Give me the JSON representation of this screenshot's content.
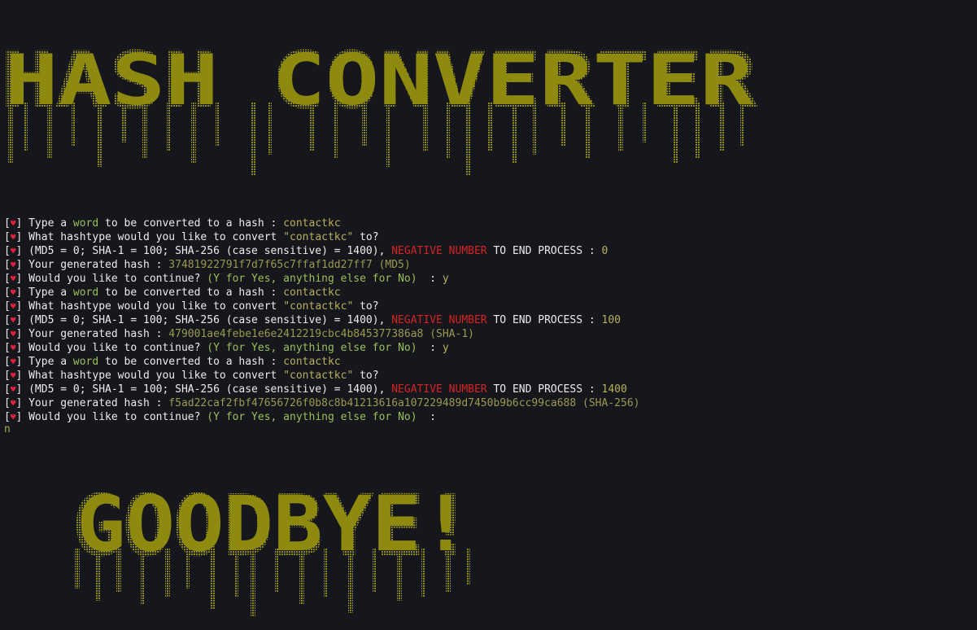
{
  "theme": {
    "background": "#16171c",
    "banner_color": "#8e8a10",
    "heart_color": "#e0213a"
  },
  "banners": {
    "top": "HASH CONVERTER",
    "bottom": "GOODBYE!"
  },
  "prompt_icon": "heart-icon",
  "log": [
    {
      "kind": "word",
      "pre": " Type a ",
      "green": "word",
      "post": " to be converted to a hash : ",
      "input": "contactkc"
    },
    {
      "kind": "which",
      "pre": " What hashtype would you like to convert ",
      "quoted": "\"contactkc\"",
      "post": " to?"
    },
    {
      "kind": "menu",
      "pre": " (MD5 = 0; SHA-1 = 100; SHA-256 (case sensitive) = 1400), ",
      "red": "NEGATIVE NUMBER",
      "post": " TO END PROCESS : ",
      "input": "0"
    },
    {
      "kind": "hash",
      "pre": " Your generated hash : ",
      "hash": "37481922791f7d7f65c7ffaf1dd27ff7 (MD5)"
    },
    {
      "kind": "cont",
      "pre": " Would you like to continue? ",
      "green": "(Y for Yes, anything else for No)",
      "post": "  : ",
      "input": "y"
    },
    {
      "kind": "word",
      "pre": " Type a ",
      "green": "word",
      "post": " to be converted to a hash : ",
      "input": "contactkc"
    },
    {
      "kind": "which",
      "pre": " What hashtype would you like to convert ",
      "quoted": "\"contactkc\"",
      "post": " to?"
    },
    {
      "kind": "menu",
      "pre": " (MD5 = 0; SHA-1 = 100; SHA-256 (case sensitive) = 1400), ",
      "red": "NEGATIVE NUMBER",
      "post": " TO END PROCESS : ",
      "input": "100"
    },
    {
      "kind": "hash",
      "pre": " Your generated hash : ",
      "hash": "479001ae4febe1e6e2412219cbc4b845377386a8 (SHA-1)"
    },
    {
      "kind": "cont",
      "pre": " Would you like to continue? ",
      "green": "(Y for Yes, anything else for No)",
      "post": "  : ",
      "input": "y"
    },
    {
      "kind": "word",
      "pre": " Type a ",
      "green": "word",
      "post": " to be converted to a hash : ",
      "input": "contactkc"
    },
    {
      "kind": "which",
      "pre": " What hashtype would you like to convert ",
      "quoted": "\"contactkc\"",
      "post": " to?"
    },
    {
      "kind": "menu",
      "pre": " (MD5 = 0; SHA-1 = 100; SHA-256 (case sensitive) = 1400), ",
      "red": "NEGATIVE NUMBER",
      "post": " TO END PROCESS : ",
      "input": "1400"
    },
    {
      "kind": "hash",
      "pre": " Your generated hash : ",
      "hash": "f5ad22caf2fbf47656726f0b8c8b41213616a107229489d7450b9b6cc99ca688 (SHA-256)"
    },
    {
      "kind": "cont",
      "pre": " Would you like to continue? ",
      "green": "(Y for Yes, anything else for No)",
      "post": "  : ",
      "input": ""
    }
  ],
  "final_reply": "n"
}
